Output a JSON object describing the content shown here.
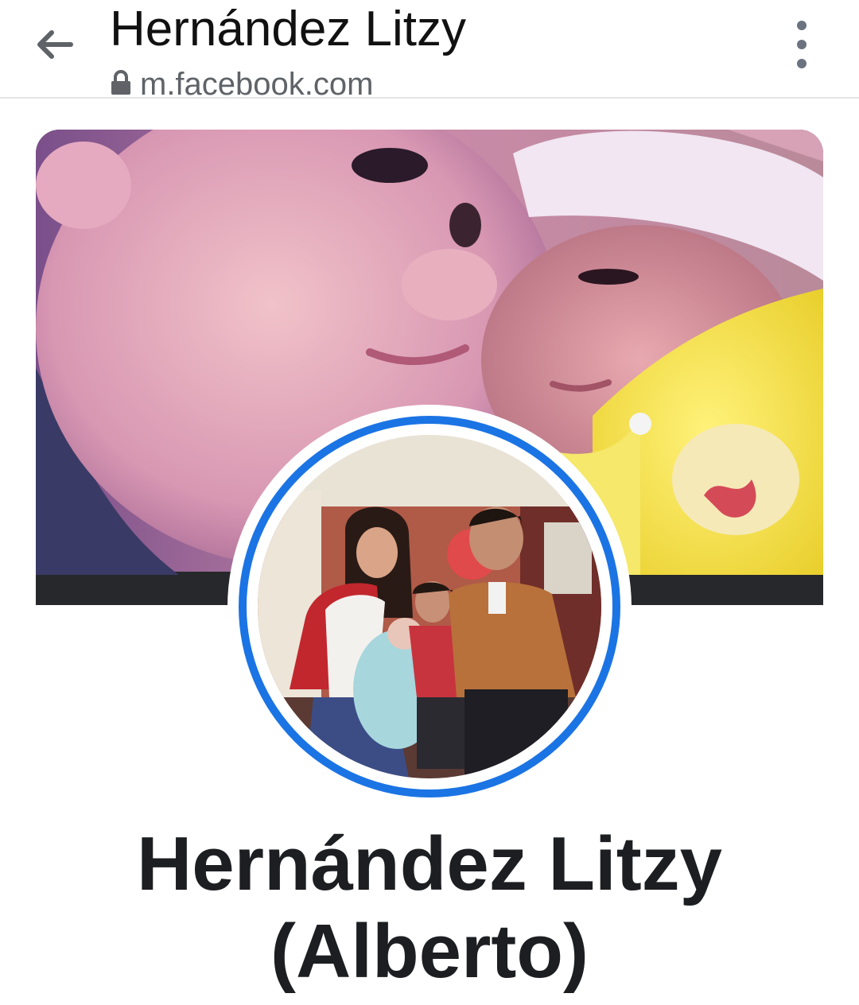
{
  "browser": {
    "tab_title": "Hernández Litzy",
    "url": "m.facebook.com"
  },
  "icons": {
    "back": "arrow-left-icon",
    "lock": "lock-icon",
    "menu": "more-vert-icon"
  },
  "profile": {
    "name_line1": "Hernández Litzy",
    "name_line2": "(Alberto)"
  },
  "colors": {
    "accent": "#1b74e4",
    "name_text": "#1c1e21",
    "url_text": "#5f6368"
  }
}
